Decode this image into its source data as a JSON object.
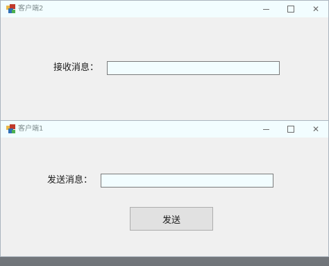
{
  "window_client2": {
    "title": "客户端2",
    "receive_label": "接收消息：",
    "receive_value": ""
  },
  "window_client1": {
    "title": "客户端1",
    "send_label": "发送消息：",
    "send_value": "",
    "send_button": "发送"
  },
  "controls": {
    "close_glyph": "✕"
  },
  "colors": {
    "window_bg": "#f0f0f0",
    "titlebar_bg": "#f2fdff",
    "textbox_bg": "#f2fdff",
    "button_bg": "#e1e1e1"
  }
}
